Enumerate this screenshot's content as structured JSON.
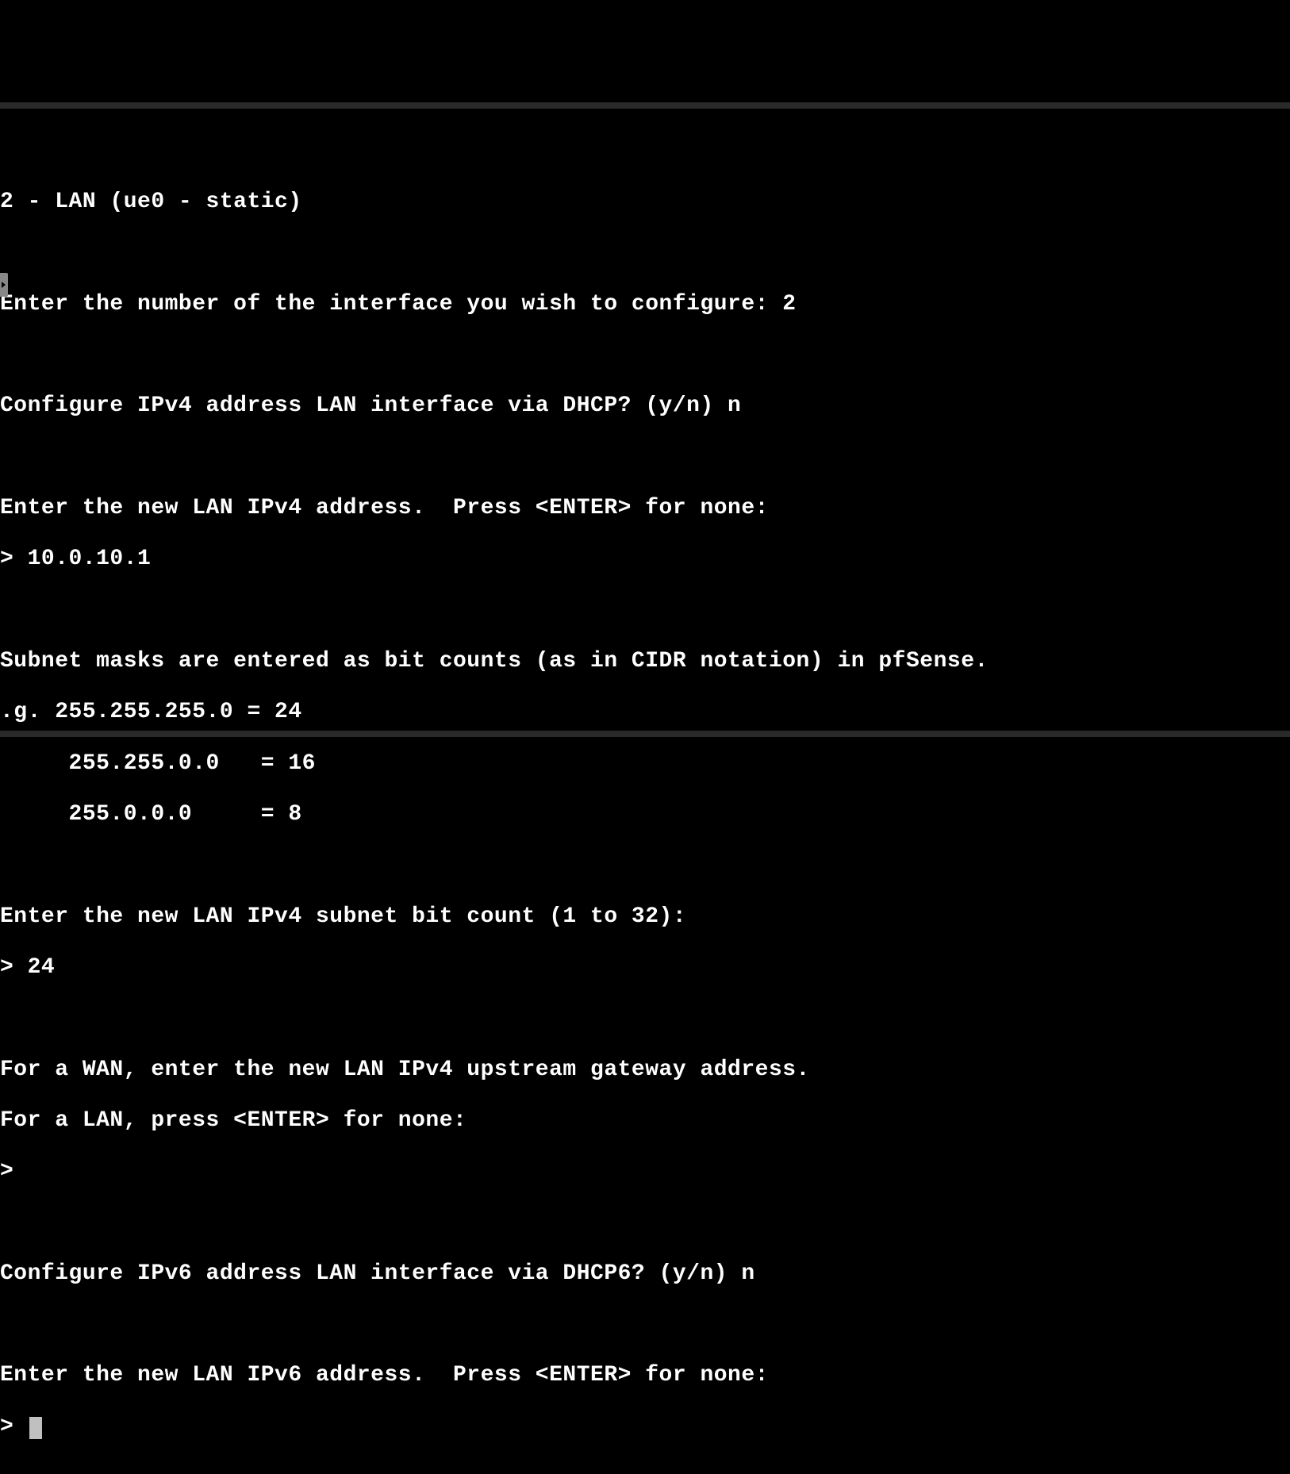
{
  "terminal": {
    "lines": [
      "2 - LAN (ue0 - static)",
      "",
      "Enter the number of the interface you wish to configure: 2",
      "",
      "Configure IPv4 address LAN interface via DHCP? (y/n) n",
      "",
      "Enter the new LAN IPv4 address.  Press <ENTER> for none:",
      "> 10.0.10.1",
      "",
      "Subnet masks are entered as bit counts (as in CIDR notation) in pfSense.",
      ".g. 255.255.255.0 = 24",
      "     255.255.0.0   = 16",
      "     255.0.0.0     = 8",
      "",
      "Enter the new LAN IPv4 subnet bit count (1 to 32):",
      "> 24",
      "",
      "For a WAN, enter the new LAN IPv4 upstream gateway address.",
      "For a LAN, press <ENTER> for none:",
      ">",
      "",
      "Configure IPv6 address LAN interface via DHCP6? (y/n) n",
      "",
      "Enter the new LAN IPv6 address.  Press <ENTER> for none:"
    ],
    "prompt_final": "> "
  }
}
